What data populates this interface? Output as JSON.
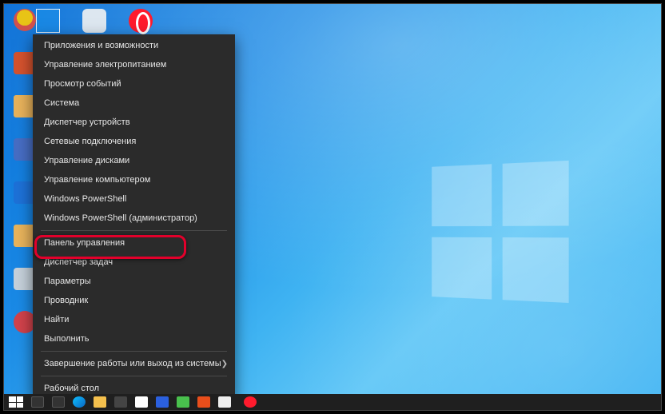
{
  "power_menu": {
    "items": [
      {
        "label": "Приложения и возможности"
      },
      {
        "label": "Управление электропитанием"
      },
      {
        "label": "Просмотр событий"
      },
      {
        "label": "Система"
      },
      {
        "label": "Диспетчер устройств"
      },
      {
        "label": "Сетевые подключения"
      },
      {
        "label": "Управление дисками"
      },
      {
        "label": "Управление компьютером"
      },
      {
        "label": "Windows PowerShell"
      },
      {
        "label": "Windows PowerShell (администратор)"
      }
    ],
    "items2": [
      {
        "label": "Панель управления"
      },
      {
        "label": "Диспетчер задач"
      },
      {
        "label": "Параметры"
      },
      {
        "label": "Проводник"
      },
      {
        "label": "Найти"
      },
      {
        "label": "Выполнить"
      }
    ],
    "items3": [
      {
        "label": "Завершение работы или выход из системы",
        "has_submenu": true
      }
    ],
    "items4": [
      {
        "label": "Рабочий стол"
      }
    ],
    "highlighted_index": 9
  },
  "highlight_color": "#e3002b",
  "taskbar": {
    "icons": [
      "start",
      "search",
      "taskview",
      "edge",
      "folder",
      "store",
      "mail",
      "app",
      "green",
      "anydesk",
      "white"
    ]
  }
}
